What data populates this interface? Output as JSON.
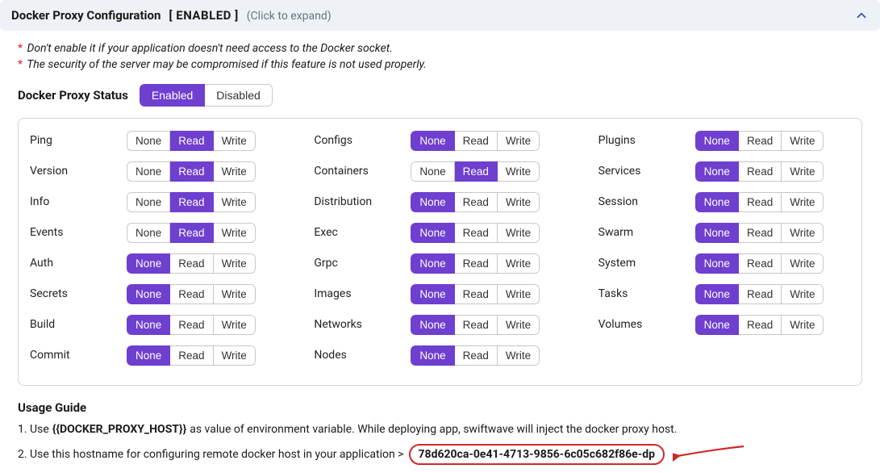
{
  "header": {
    "title": "Docker Proxy Configuration",
    "enabled_tag": "[ ENABLED ]",
    "hint": "(Click to expand)"
  },
  "warnings": [
    "Don't enable it if your application doesn't need access to the Docker socket.",
    "The security of the server may be compromised if this feature is not used properly."
  ],
  "status": {
    "label": "Docker Proxy Status",
    "enabled_btn": "Enabled",
    "disabled_btn": "Disabled",
    "active": "enabled"
  },
  "perm_options": {
    "none": "None",
    "read": "Read",
    "write": "Write"
  },
  "perm_columns": [
    [
      {
        "label": "Ping",
        "active": "read"
      },
      {
        "label": "Version",
        "active": "read"
      },
      {
        "label": "Info",
        "active": "read"
      },
      {
        "label": "Events",
        "active": "read"
      },
      {
        "label": "Auth",
        "active": "none"
      },
      {
        "label": "Secrets",
        "active": "none"
      },
      {
        "label": "Build",
        "active": "none"
      },
      {
        "label": "Commit",
        "active": "none"
      }
    ],
    [
      {
        "label": "Configs",
        "active": "none"
      },
      {
        "label": "Containers",
        "active": "read"
      },
      {
        "label": "Distribution",
        "active": "none"
      },
      {
        "label": "Exec",
        "active": "none"
      },
      {
        "label": "Grpc",
        "active": "none"
      },
      {
        "label": "Images",
        "active": "none"
      },
      {
        "label": "Networks",
        "active": "none"
      },
      {
        "label": "Nodes",
        "active": "none"
      }
    ],
    [
      {
        "label": "Plugins",
        "active": "none"
      },
      {
        "label": "Services",
        "active": "none"
      },
      {
        "label": "Session",
        "active": "none"
      },
      {
        "label": "Swarm",
        "active": "none"
      },
      {
        "label": "System",
        "active": "none"
      },
      {
        "label": "Tasks",
        "active": "none"
      },
      {
        "label": "Volumes",
        "active": "none"
      }
    ]
  ],
  "guide": {
    "title": "Usage Guide",
    "line1_a": "1. Use ",
    "line1_var": "{{DOCKER_PROXY_HOST}}",
    "line1_b": " as value of environment variable. While deploying app, swiftwave will inject the docker proxy host.",
    "line2_a": "2. Use this hostname for configuring remote docker host in your application >",
    "hostname": "78d620ca-0e41-4713-9856-6c05c682f86e-dp"
  }
}
